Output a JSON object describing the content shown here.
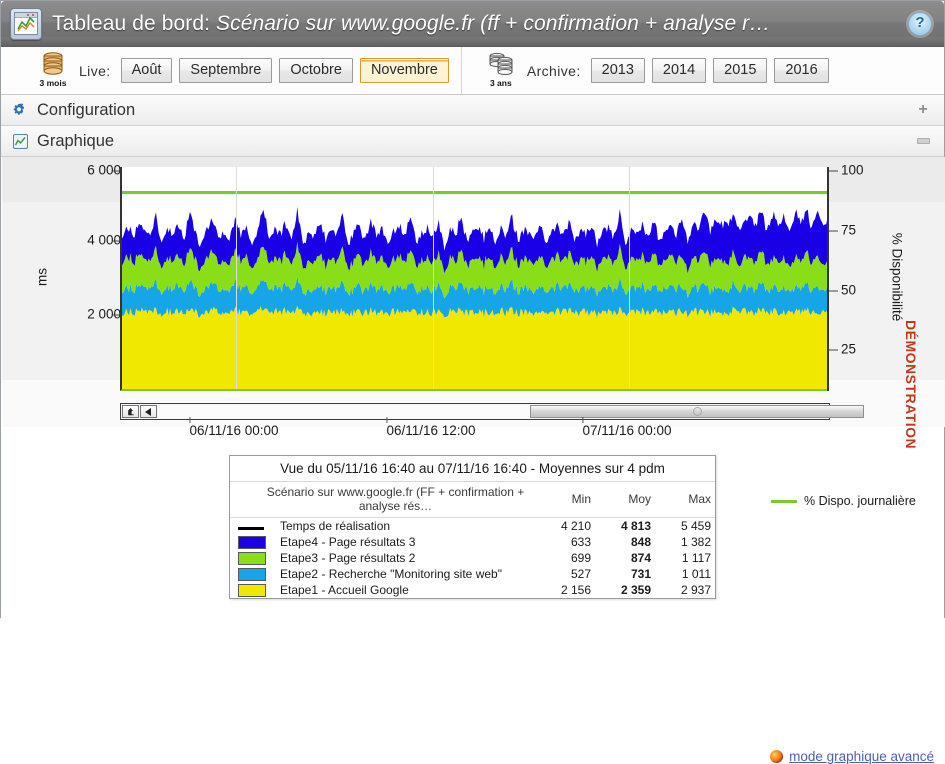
{
  "window": {
    "title_prefix": "Tableau de bord: ",
    "title_scenario": "Scénario sur www.google.fr (ff + confirmation + analyse r…",
    "icon": "dashboard-chart-icon",
    "help_icon": "help-question-icon"
  },
  "toolbar": {
    "live": {
      "icon": "database-3-months-icon",
      "icon_caption": "3 mois",
      "label": "Live:",
      "buttons": [
        {
          "label": "Août",
          "selected": false
        },
        {
          "label": "Septembre",
          "selected": false
        },
        {
          "label": "Octobre",
          "selected": false
        },
        {
          "label": "Novembre",
          "selected": true
        }
      ]
    },
    "archive": {
      "icon": "database-3-years-icon",
      "icon_caption": "3 ans",
      "label": "Archive:",
      "buttons": [
        {
          "label": "2013",
          "selected": false
        },
        {
          "label": "2014",
          "selected": false
        },
        {
          "label": "2015",
          "selected": false
        },
        {
          "label": "2016",
          "selected": false
        }
      ]
    }
  },
  "sections": [
    {
      "label": "Configuration",
      "icon": "gear-icon",
      "toggle": "plus"
    },
    {
      "label": "Graphique",
      "icon": "chart-panel-icon",
      "toggle": "minus"
    }
  ],
  "chart_data": {
    "type": "area",
    "title": "",
    "stacked": true,
    "xlabel": "",
    "ylabel": "ms",
    "ylabel_right": "% Disponibilité",
    "watermark": "DÉMONSTRATION",
    "watermark_color": "#c1381a",
    "ylim": [
      0,
      6800
    ],
    "yticks": [
      2000,
      4000,
      6000
    ],
    "ytick_labels": [
      "2 000",
      "4 000",
      "6 000"
    ],
    "ylim_right": [
      0,
      113
    ],
    "yticks_right": [
      25,
      50,
      75,
      100
    ],
    "ytick_labels_right": [
      "25",
      "50",
      "75",
      "100"
    ],
    "grid": true,
    "legend_position": "below",
    "x_tick_labels": [
      "06/11/16 00:00",
      "06/11/16 12:00",
      "07/11/16 00:00"
    ],
    "x_tick_positions": [
      232,
      430,
      625
    ],
    "availability_line": {
      "name": "% Dispo. journalière",
      "color": "#7ccb2a",
      "value": 100
    },
    "series": [
      {
        "name": "Etape1 - Accueil Google",
        "color": "#f0e800",
        "order": 1,
        "min": 2156,
        "moy": 2359,
        "max": 2937,
        "values": [
          2360,
          2380,
          2340,
          2400,
          2355,
          2330,
          2420,
          2300,
          2370,
          2345,
          2390,
          2310,
          2430,
          2350,
          2290,
          2375,
          2410,
          2330,
          2360,
          2300,
          2415,
          2340,
          2385,
          2320,
          2360,
          2440,
          2310,
          2370,
          2345,
          2395,
          2330,
          2420,
          2280,
          2365,
          2340,
          2400,
          2310,
          2375,
          2355,
          2430,
          2290,
          2360,
          2385,
          2320,
          2410,
          2340,
          2370,
          2300,
          2355,
          2395,
          2330,
          2425,
          2310,
          2365,
          2380,
          2340,
          2400,
          2290,
          2370,
          2350,
          2415,
          2320,
          2360,
          2385,
          2330,
          2395,
          2300,
          2370,
          2345,
          2420,
          2310,
          2375,
          2355,
          2340,
          2400,
          2290,
          2365,
          2380,
          2330,
          2410,
          2320,
          2370,
          2350,
          2395,
          2305,
          2360,
          2385,
          2340,
          2425,
          2300,
          2370,
          2355,
          2390,
          2330,
          2410,
          2315,
          2365,
          2380,
          2345,
          2400,
          2290,
          2370,
          2350,
          2420,
          2310,
          2375,
          2360,
          2335,
          2405,
          2295,
          2368,
          2382,
          2340,
          2415,
          2320,
          2360,
          2350,
          2390,
          2300,
          2370,
          2355,
          2398,
          2330,
          2412,
          2310,
          2366
        ]
      },
      {
        "name": "Etape2 - Recherche \"Monitoring site web\"",
        "color": "#16a6e8",
        "order": 2,
        "min": 527,
        "moy": 731,
        "max": 1011,
        "values": [
          730,
          760,
          700,
          800,
          720,
          690,
          860,
          650,
          740,
          710,
          780,
          660,
          900,
          700,
          620,
          750,
          820,
          670,
          735,
          640,
          840,
          690,
          770,
          630,
          730,
          930,
          660,
          745,
          700,
          790,
          670,
          870,
          600,
          735,
          690,
          800,
          650,
          755,
          710,
          890,
          615,
          730,
          775,
          640,
          830,
          695,
          750,
          630,
          725,
          790,
          665,
          880,
          640,
          735,
          765,
          690,
          800,
          600,
          745,
          705,
          845,
          645,
          730,
          775,
          670,
          795,
          625,
          745,
          700,
          870,
          650,
          755,
          715,
          690,
          805,
          605,
          735,
          770,
          665,
          835,
          640,
          745,
          705,
          790,
          615,
          730,
          780,
          690,
          885,
          620,
          745,
          710,
          785,
          665,
          830,
          635,
          735,
          775,
          695,
          800,
          605,
          745,
          705,
          870,
          650,
          755,
          730,
          680,
          810,
          610,
          740,
          770,
          690,
          840,
          645,
          730,
          700,
          785,
          620,
          745,
          710,
          800,
          665,
          825,
          640,
          735
        ]
      },
      {
        "name": "Etape3 - Page résultats 2",
        "color": "#8ade18",
        "order": 3,
        "min": 699,
        "moy": 874,
        "max": 1117,
        "values": [
          880,
          910,
          850,
          950,
          870,
          840,
          1010,
          800,
          890,
          860,
          930,
          810,
          1050,
          850,
          770,
          900,
          970,
          820,
          885,
          790,
          990,
          840,
          920,
          780,
          880,
          1080,
          810,
          895,
          850,
          940,
          820,
          1020,
          750,
          885,
          840,
          950,
          800,
          905,
          860,
          1040,
          765,
          880,
          925,
          790,
          980,
          845,
          900,
          780,
          875,
          940,
          815,
          1030,
          790,
          885,
          915,
          840,
          950,
          750,
          895,
          855,
          995,
          795,
          880,
          925,
          820,
          945,
          775,
          895,
          850,
          1020,
          800,
          905,
          865,
          840,
          955,
          755,
          885,
          920,
          815,
          985,
          790,
          895,
          855,
          940,
          765,
          880,
          930,
          840,
          1035,
          770,
          895,
          860,
          935,
          815,
          980,
          785,
          885,
          925,
          845,
          950,
          755,
          895,
          855,
          1020,
          800,
          905,
          880,
          830,
          960,
          760,
          890,
          920,
          840,
          990,
          795,
          880,
          850,
          935,
          770,
          895,
          860,
          950,
          815,
          975,
          790,
          885
        ]
      },
      {
        "name": "Etape4 - Page résultats 3",
        "color": "#1a00e6",
        "order": 4,
        "min": 633,
        "moy": 848,
        "max": 1382,
        "values": [
          850,
          890,
          820,
          940,
          860,
          810,
          1010,
          780,
          870,
          840,
          910,
          790,
          1060,
          830,
          740,
          880,
          960,
          800,
          865,
          760,
          980,
          820,
          900,
          750,
          860,
          1090,
          780,
          875,
          830,
          920,
          800,
          1020,
          720,
          865,
          820,
          930,
          770,
          885,
          840,
          1050,
          735,
          860,
          905,
          760,
          970,
          825,
          880,
          750,
          855,
          920,
          785,
          1030,
          760,
          865,
          895,
          820,
          930,
          720,
          875,
          835,
          985,
          765,
          860,
          905,
          790,
          925,
          745,
          875,
          830,
          1020,
          770,
          885,
          845,
          820,
          935,
          725,
          865,
          900,
          785,
          975,
          760,
          875,
          835,
          920,
          735,
          860,
          910,
          820,
          1040,
          740,
          875,
          840,
          915,
          785,
          980,
          755,
          865,
          905,
          825,
          1140,
          860,
          1050,
          980,
          1220,
          1060,
          1150,
          1090,
          1260,
          1100,
          1180,
          1040,
          1290,
          1120,
          1200,
          1070,
          1310,
          1150,
          1230,
          1080,
          1340,
          1170,
          1250,
          1100,
          1380,
          1190,
          1260,
          1120
        ]
      }
    ],
    "total_line": {
      "name": "Temps de réalisation",
      "color": "#000000",
      "min": 4210,
      "moy": 4813,
      "max": 5459
    }
  },
  "scrollbar": {
    "up_button_icon": "scroll-up-icon",
    "left_button_icon": "scroll-left-icon",
    "right_button_icon": "scroll-right-icon",
    "thumb_grip_icon": "thumb-grip-icon"
  },
  "legend_panel": {
    "title": "Vue du 05/11/16 16:40 au 07/11/16 16:40 - Moyennes sur 4 pdm",
    "columns": [
      "Scénario sur www.google.fr (FF + confirmation + analyse rés…",
      "Min",
      "Moy",
      "Max"
    ],
    "rows": [
      {
        "swatch": "line",
        "color": "#000000",
        "label": "Temps de réalisation",
        "min": "4 210",
        "moy": "4 813",
        "max": "5 459"
      },
      {
        "swatch": "block",
        "color": "#1a00e6",
        "label": "Etape4 - Page résultats 3",
        "min": "633",
        "moy": "848",
        "max": "1 382"
      },
      {
        "swatch": "block",
        "color": "#8ade18",
        "label": "Etape3 - Page résultats 2",
        "min": "699",
        "moy": "874",
        "max": "1 117"
      },
      {
        "swatch": "block",
        "color": "#16a6e8",
        "label": "Etape2 - Recherche \"Monitoring site web\"",
        "min": "527",
        "moy": "731",
        "max": "1 011"
      },
      {
        "swatch": "block",
        "color": "#f0e800",
        "label": "Etape1 - Accueil Google",
        "min": "2 156",
        "moy": "2 359",
        "max": "2 937"
      }
    ]
  },
  "dispo_legend": {
    "label": "% Dispo. journalière",
    "color": "#7ccb2a"
  },
  "advanced_link": {
    "icon": "firefox-icon",
    "label": "mode graphique avancé"
  }
}
